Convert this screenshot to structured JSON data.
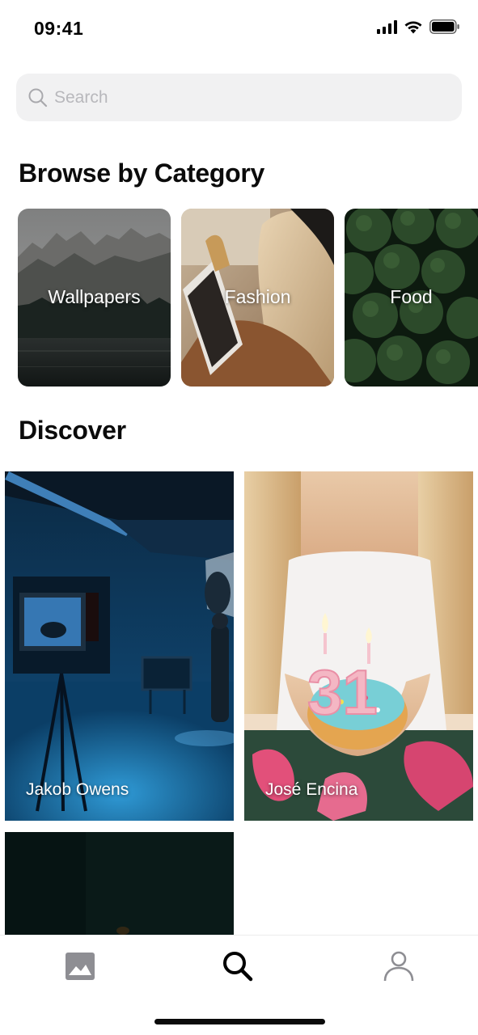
{
  "status_bar": {
    "time": "09:41"
  },
  "search": {
    "placeholder": "Search",
    "value": ""
  },
  "categories_section": {
    "title": "Browse by Category",
    "items": [
      {
        "label": "Wallpapers"
      },
      {
        "label": "Fashion"
      },
      {
        "label": "Food"
      }
    ]
  },
  "discover_section": {
    "title": "Discover",
    "photos": [
      {
        "credit": "Jakob Owens"
      },
      {
        "credit": "José Encina"
      },
      {
        "credit": ""
      }
    ]
  },
  "tab_bar": {
    "items": [
      {
        "icon": "image-icon"
      },
      {
        "icon": "search-icon",
        "active": true
      },
      {
        "icon": "person-icon"
      }
    ]
  },
  "colors": {
    "search_bg": "#f1f1f2",
    "placeholder": "#b8b8bc",
    "active_tab": "#000000",
    "inactive_tab": "#8e8e93"
  }
}
